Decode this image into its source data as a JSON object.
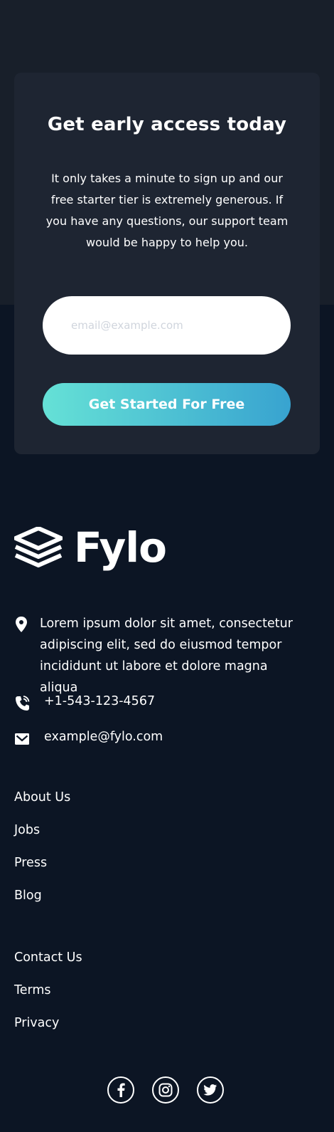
{
  "cta": {
    "title": "Get early access today",
    "body": "It only takes a minute to sign up and our free starter tier is extremely generous. If you have any questions, our support team would be happy to help you.",
    "email_placeholder": "email@example.com",
    "button_label": "Get Started For Free"
  },
  "footer": {
    "logo_text": "Fylo",
    "contact": {
      "address": "Lorem ipsum dolor sit amet, consectetur adipiscing elit, sed do eiusmod tempor incididunt ut labore et dolore magna aliqua",
      "phone": "+1-543-123-4567",
      "email": "example@fylo.com"
    },
    "links_primary": [
      "About Us",
      "Jobs",
      "Press",
      "Blog"
    ],
    "links_secondary": [
      "Contact Us",
      "Terms",
      "Privacy"
    ],
    "social_icons": [
      "facebook-icon",
      "instagram-icon",
      "twitter-icon"
    ]
  },
  "colors": {
    "page_bg": "#0c1524",
    "top_band": "#181f2a",
    "card_bg": "#1e2532",
    "gradient_start": "#65e1d6",
    "gradient_end": "#38a3d0"
  }
}
